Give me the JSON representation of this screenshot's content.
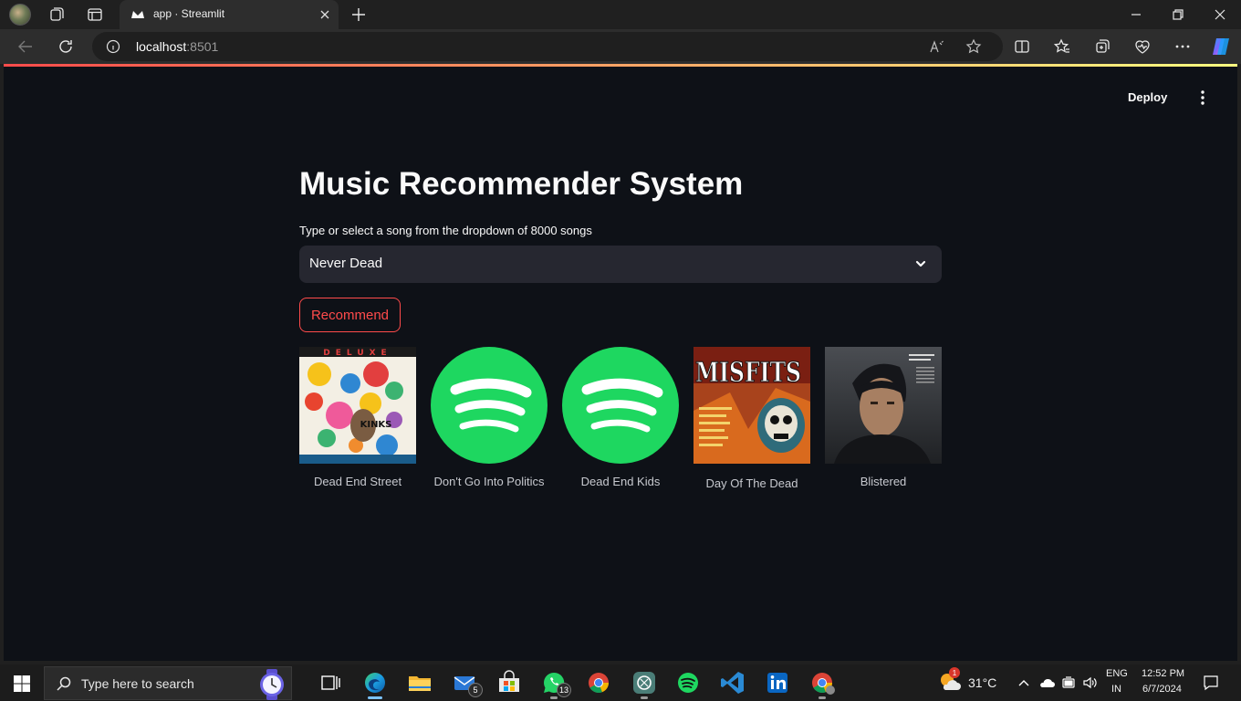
{
  "browser": {
    "tab_title": "app · Streamlit",
    "url_host": "localhost",
    "url_port": ":8501"
  },
  "app": {
    "deploy_label": "Deploy",
    "title": "Music Recommender System",
    "select_label": "Type or select a song from the dropdown of 8000 songs",
    "selected_song": "Never Dead",
    "recommend_label": "Recommend",
    "recommendations": [
      {
        "name": "Dead End Street",
        "cover": "kinks-face-to-face-album-art"
      },
      {
        "name": "Don't Go Into Politics",
        "cover": "spotify-logo"
      },
      {
        "name": "Dead End Kids",
        "cover": "spotify-logo"
      },
      {
        "name": "Day Of The Dead",
        "cover": "misfits-american-psycho-album-art"
      },
      {
        "name": "Blistered",
        "cover": "johnny-cash-portrait-album-art"
      }
    ],
    "album_text": {
      "deluxe": "DELUXE",
      "kinks": "KINKS",
      "misfits": "MISFITS"
    },
    "colors": {
      "background": "#0e1117",
      "accent": "#ff4b4b",
      "spotify_green": "#1ed760"
    }
  },
  "taskbar": {
    "search_placeholder": "Type here to search",
    "mail_badge": "5",
    "whatsapp_badge": "13",
    "temperature": "31°C",
    "lang_1": "ENG",
    "lang_2": "IN",
    "time": "12:52 PM",
    "date": "6/7/2024",
    "weather_badge": "1"
  }
}
